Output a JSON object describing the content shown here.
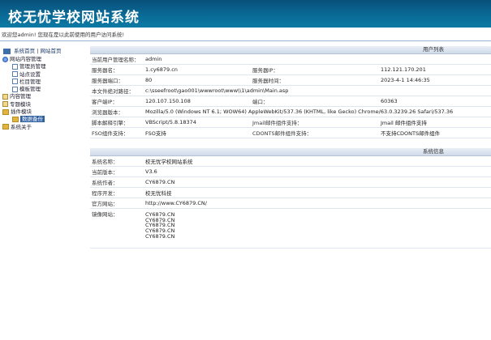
{
  "app": {
    "title": "校无忧学校网站系统"
  },
  "welcome": "欢迎您admin! 您现在是以此前使用的用户访问系统!",
  "sidebar": {
    "nav_home": "系统首页",
    "nav_site": "网站首页",
    "tree": [
      {
        "label": "网站内容管理",
        "icon": "globe-icon",
        "level": 1
      },
      {
        "label": "管理员管理",
        "icon": "doc-icon",
        "level": 2
      },
      {
        "label": "站点设置",
        "icon": "doc-icon",
        "level": 2
      },
      {
        "label": "栏目管理",
        "icon": "doc-icon",
        "level": 2
      },
      {
        "label": "模板管理",
        "icon": "doc-icon",
        "level": 2
      },
      {
        "label": "内容管理",
        "icon": "plus-icon",
        "level": 1
      },
      {
        "label": "专题模块",
        "icon": "plus-icon",
        "level": 1
      },
      {
        "label": "插件模块",
        "icon": "folder-icon",
        "level": 1
      },
      {
        "label": "数据备份",
        "icon": "folder-icon",
        "level": 2,
        "selected": true
      },
      {
        "label": "系统关于",
        "icon": "folder-icon",
        "level": 1
      }
    ]
  },
  "user_section": {
    "header": "用户列表"
  },
  "user_rows": [
    {
      "l1": "当前用户管理名称：",
      "v1": "admin",
      "l2": "",
      "v2": ""
    },
    {
      "l1": "服务器名：",
      "v1": "1.cy6879.cn",
      "l2": "服务器IP：",
      "v2": "112.121.170.201"
    },
    {
      "l1": "服务器端口：",
      "v1": "80",
      "l2": "服务器时间：",
      "v2": "2023-4-1 14:46:35"
    },
    {
      "l1": "本文件绝对路径：",
      "v1": "c:\\sseefroot\\gao001\\wwwroot\\www\\\\1\\admin\\Main.asp",
      "l2": "",
      "v2": ""
    },
    {
      "l1": "客户端IP：",
      "v1": "120.107.150.108",
      "l2": "端口：",
      "v2": "60363"
    },
    {
      "l1": "浏览器版本：",
      "v1": "Mozilla/5.0 (Windows NT 6.1; WOW64) AppleWebKit/537.36 (KHTML, like Gecko) Chrome/63.0.3239.26 Safari/537.36",
      "l2": "",
      "v2": ""
    },
    {
      "l1": "脚本解释引擎：",
      "v1": "VBScript/5.8.18374",
      "l2": "Jmail邮件组件支持：",
      "v2": "Jmail 邮件组件支持"
    },
    {
      "l1": "FSO组件支持：",
      "v1": "FSO支持",
      "l2": "CDONTS邮件组件支持：",
      "v2": "不支持CDONTS邮件组件"
    }
  ],
  "sys_section": {
    "header": "系统信息"
  },
  "sys_rows": [
    {
      "label": "系统名称：",
      "value": "校无忧学校网站系统"
    },
    {
      "label": "当前版本：",
      "value": "V3.6"
    },
    {
      "label": "系统作者：",
      "value": "CY6879.CN"
    },
    {
      "label": "程序开发：",
      "value": "校无忧科技"
    },
    {
      "label": "官方网站：",
      "value": "http://www.CY6879.CN/"
    }
  ],
  "mirror": {
    "label": "镜像网站：",
    "values": [
      "CY6879.CN",
      "CY6879.CN",
      "CY6879.CN",
      "CY6879.CN",
      "CY6879.CN"
    ]
  }
}
